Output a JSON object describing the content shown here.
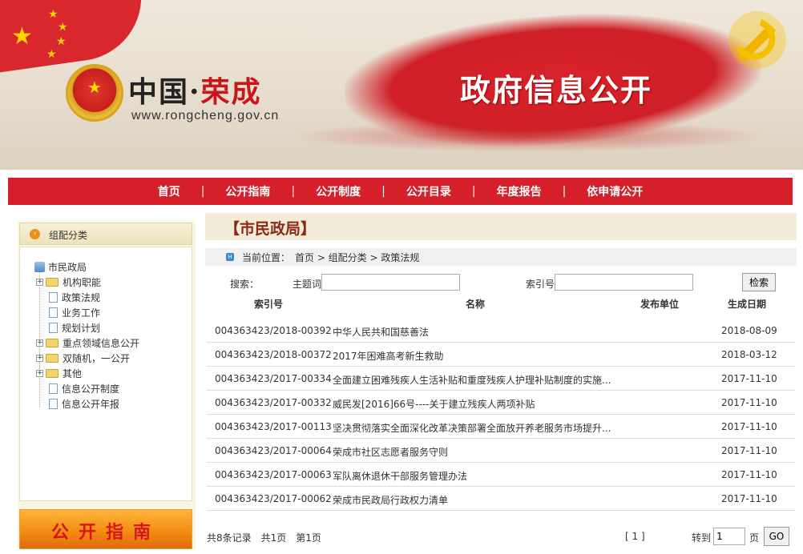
{
  "banner": {
    "site_name_prefix": "中国·",
    "site_name_city": "荣成",
    "site_url": "www.rongcheng.gov.cn",
    "title": "政府信息公开"
  },
  "nav": {
    "items": [
      "首页",
      "公开指南",
      "公开制度",
      "公开目录",
      "年度报告",
      "依申请公开"
    ],
    "separator": "|"
  },
  "sidebar": {
    "header": "组配分类",
    "tree": [
      {
        "label": "市民政局"
      },
      {
        "label": "机构职能"
      },
      {
        "label": "政策法规"
      },
      {
        "label": "业务工作"
      },
      {
        "label": "规划计划"
      },
      {
        "label": "重点领域信息公开"
      },
      {
        "label": "双随机，一公开"
      },
      {
        "label": "其他"
      },
      {
        "label": "信息公开制度"
      },
      {
        "label": "信息公开年报"
      }
    ],
    "guide_label": "公开指南"
  },
  "main": {
    "title": "【市民政局】",
    "breadcrumb": "当前位置：　首页 > 组配分类 > 政策法规",
    "search": {
      "label": "搜索：",
      "topic_label": "主题词",
      "topic_value": "",
      "index_label": "索引号",
      "index_value": "",
      "button": "检索"
    },
    "columns": {
      "index": "索引号",
      "name": "名称",
      "publisher": "发布单位",
      "date": "生成日期"
    },
    "rows": [
      {
        "index": "004363423/2018-00392",
        "name": "中华人民共和国慈善法",
        "date": "2018-08-09"
      },
      {
        "index": "004363423/2018-00372",
        "name": "2017年困难高考新生救助",
        "date": "2018-03-12"
      },
      {
        "index": "004363423/2017-00334",
        "name": "全面建立困难残疾人生活补贴和重度残疾人护理补贴制度的实施...",
        "date": "2017-11-10"
      },
      {
        "index": "004363423/2017-00332",
        "name": "威民发[2016]66号----关于建立残疾人两项补贴",
        "date": "2017-11-10"
      },
      {
        "index": "004363423/2017-00113",
        "name": "坚决贯彻落实全面深化改革决策部署全面放开养老服务市场提升...",
        "date": "2017-11-10"
      },
      {
        "index": "004363423/2017-00064",
        "name": "荣成市社区志愿者服务守则",
        "date": "2017-11-10"
      },
      {
        "index": "004363423/2017-00063",
        "name": "军队离休退休干部服务管理办法",
        "date": "2017-11-10"
      },
      {
        "index": "004363423/2017-00062",
        "name": "荣成市民政局行政权力清单",
        "date": "2017-11-10"
      }
    ],
    "pager": {
      "summary": "共8条记录　共1页　第1页",
      "pages": "[ 1 ]",
      "goto_label": "转到",
      "page_value": "1",
      "page_unit": "页",
      "go_button": "GO"
    }
  },
  "colors": {
    "nav_red": "#d51f2b",
    "title_brown": "#8a2a16",
    "sidebar_bg": "#fbf6e3"
  }
}
